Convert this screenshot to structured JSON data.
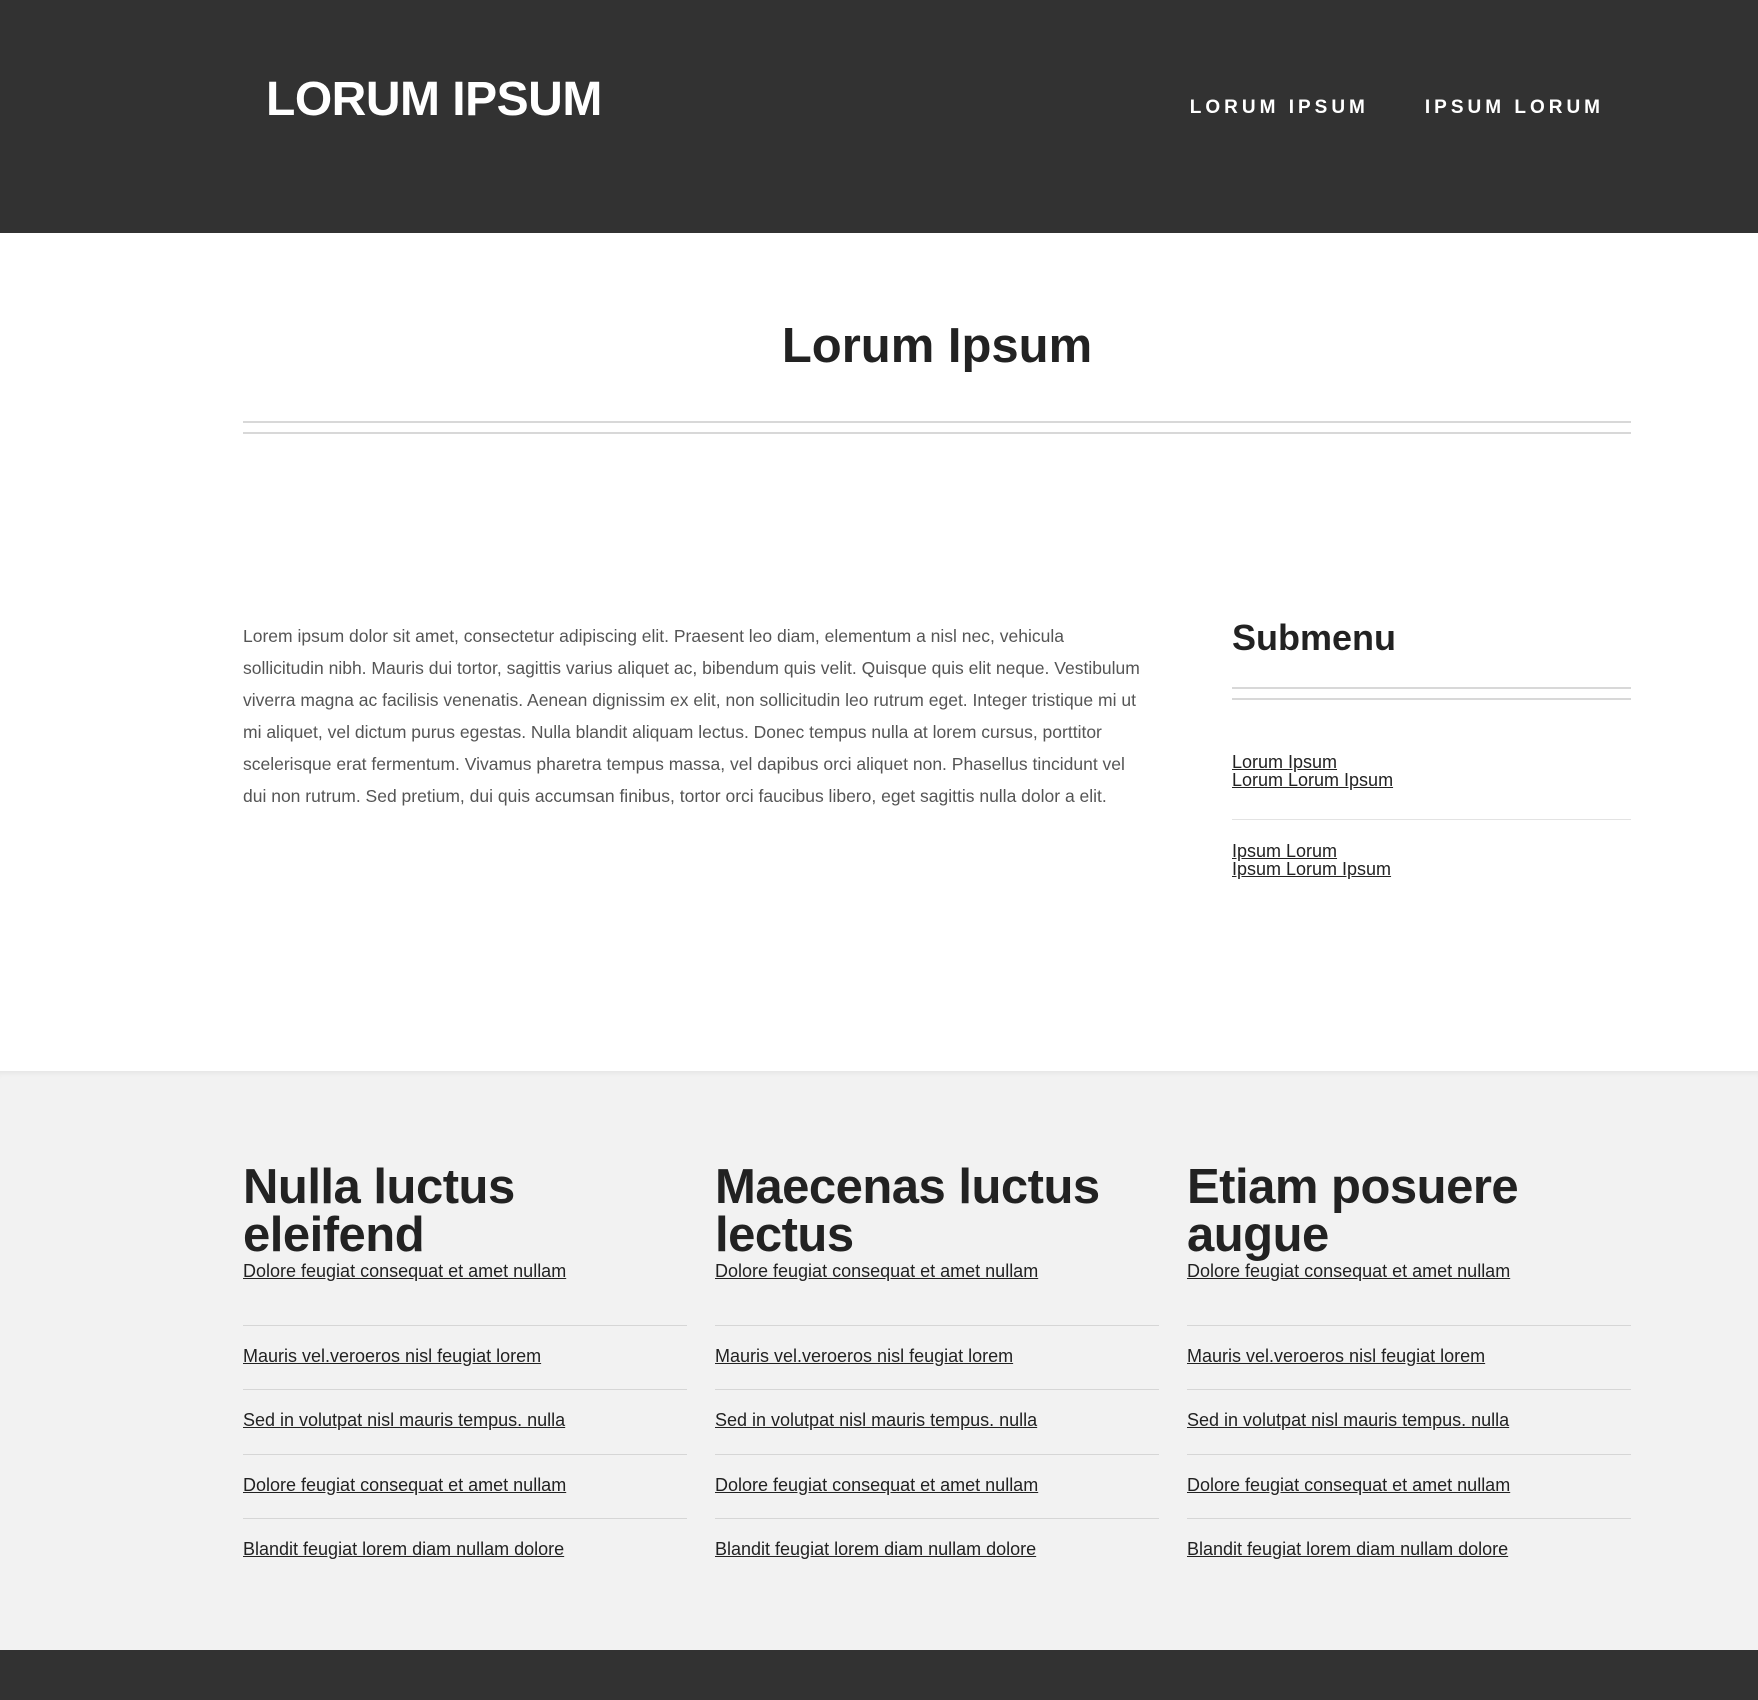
{
  "header": {
    "logo": "LORUM IPSUM",
    "nav": [
      "LORUM IPSUM",
      "IPSUM LORUM"
    ]
  },
  "main": {
    "title": "Lorum Ipsum",
    "body": "Lorem ipsum dolor sit amet, consectetur adipiscing elit. Praesent leo diam, elementum a nisl nec, vehicula sollicitudin nibh. Mauris dui tortor, sagittis varius aliquet ac, bibendum quis velit. Quisque quis elit neque. Vestibulum viverra magna ac facilisis venenatis. Aenean dignissim ex elit, non sollicitudin leo rutrum eget. Integer tristique mi ut mi aliquet, vel dictum purus egestas. Nulla blandit aliquam lectus. Donec tempus nulla at lorem cursus, porttitor scelerisque erat fermentum. Vivamus pharetra tempus massa, vel dapibus orci aliquet non. Phasellus tincidunt vel dui non rutrum. Sed pretium, dui quis accumsan finibus, tortor orci faucibus libero, eget sagittis nulla dolor a elit."
  },
  "submenu": {
    "title": "Submenu",
    "groups": [
      [
        "Lorum Ipsum",
        "Lorum Lorum Ipsum"
      ],
      [
        "Ipsum Lorum",
        "Ipsum Lorum Ipsum"
      ]
    ]
  },
  "columns": [
    {
      "heading": "Nulla luctus eleifend",
      "links": [
        "Dolore feugiat consequat et amet nullam",
        "Mauris vel.veroeros nisl feugiat lorem",
        "Sed in volutpat nisl mauris tempus. nulla",
        "Dolore feugiat consequat et amet nullam",
        "Blandit feugiat lorem diam nullam dolore"
      ]
    },
    {
      "heading": "Maecenas luctus lectus",
      "links": [
        "Dolore feugiat consequat et amet nullam",
        "Mauris vel.veroeros nisl feugiat lorem",
        "Sed in volutpat nisl mauris tempus. nulla",
        "Dolore feugiat consequat et amet nullam",
        "Blandit feugiat lorem diam nullam dolore"
      ]
    },
    {
      "heading": "Etiam posuere augue",
      "links": [
        "Dolore feugiat consequat et amet nullam",
        "Mauris vel.veroeros nisl feugiat lorem",
        "Sed in volutpat nisl mauris tempus. nulla",
        "Dolore feugiat consequat et amet nullam",
        "Blandit feugiat lorem diam nullam dolore"
      ]
    }
  ],
  "colors": {
    "header_bg": "#323232",
    "section_bg": "#f2f2f2",
    "text": "#222222",
    "body_text": "#555555"
  }
}
